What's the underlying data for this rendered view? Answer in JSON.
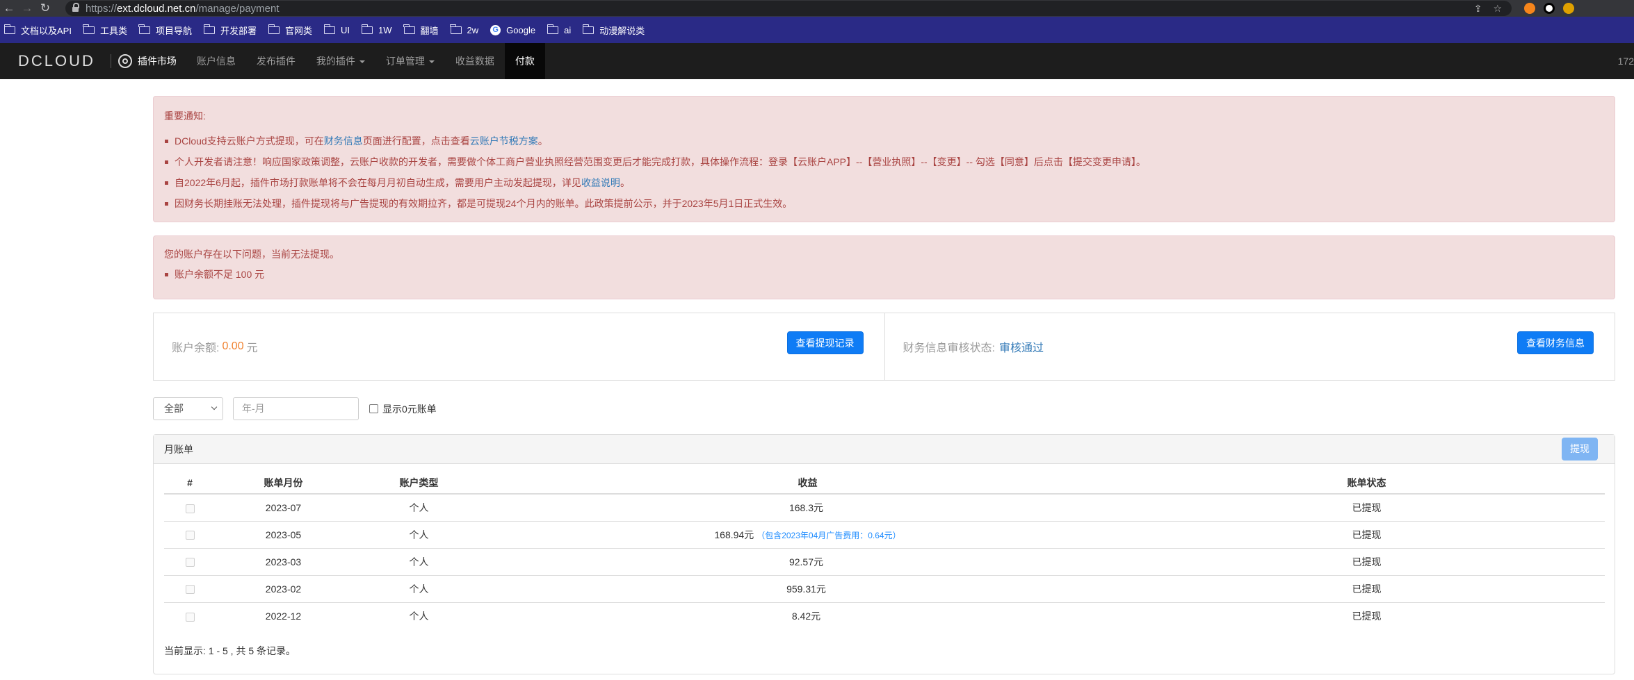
{
  "browser": {
    "url_scheme": "https://",
    "url_host": "ext.dcloud.net.cn",
    "url_path": "/manage/payment",
    "bookmarks": [
      "文档以及API",
      "工具类",
      "项目导航",
      "开发部署",
      "官网类",
      "UI",
      "1W",
      "翻墙",
      "2w",
      "Google",
      "ai",
      "动漫解说类"
    ]
  },
  "navbar": {
    "logo": "DCLOUD",
    "brand": "插件市场",
    "items": [
      "账户信息",
      "发布插件",
      "我的插件",
      "订单管理",
      "收益数据",
      "付款"
    ],
    "right_text": "172"
  },
  "notice": {
    "title": "重要通知:",
    "item1_pre": "DCloud支持云账户方式提现，可在",
    "item1_link1": "财务信息",
    "item1_mid": "页面进行配置，点击查看",
    "item1_link2": "云账户节税方案",
    "item1_end": "。",
    "item2": "个人开发者请注意！响应国家政策调整，云账户收款的开发者，需要做个体工商户营业执照经营范围变更后才能完成打款，具体操作流程：登录【云账户APP】--【营业执照】--【变更】-- 勾选【同意】后点击【提交变更申请】。",
    "item3_pre": "自2022年6月起，插件市场打款账单将不会在每月月初自动生成，需要用户主动发起提现，详见",
    "item3_link": "收益说明",
    "item3_end": "。",
    "item4": "因财务长期挂账无法处理，插件提现将与广告提现的有效期拉齐，都是可提现24个月内的账单。此政策提前公示，并于2023年5月1日正式生效。"
  },
  "issue": {
    "title": "您的账户存在以下问题，当前无法提现。",
    "item": "账户余额不足 100 元"
  },
  "balance": {
    "label": "账户余额:",
    "amount": "0.00",
    "unit": "元",
    "records_button": "查看提现记录",
    "review_label": "财务信息审核状态:",
    "review_status": "审核通过",
    "finance_button": "查看财务信息"
  },
  "filters": {
    "select_value": "全部",
    "month_placeholder": "年-月",
    "show_zero_label": "显示0元账单"
  },
  "bills": {
    "title": "月账单",
    "withdraw_button": "提现",
    "columns": [
      "#",
      "账单月份",
      "账户类型",
      "收益",
      "账单状态"
    ],
    "rows": [
      {
        "month": "2023-07",
        "type": "个人",
        "income": "168.3元",
        "note": "",
        "status": "已提现"
      },
      {
        "month": "2023-05",
        "type": "个人",
        "income": "168.94元",
        "note": "（包含2023年04月广告费用：0.64元）",
        "status": "已提现"
      },
      {
        "month": "2023-03",
        "type": "个人",
        "income": "92.57元",
        "note": "",
        "status": "已提现"
      },
      {
        "month": "2023-02",
        "type": "个人",
        "income": "959.31元",
        "note": "",
        "status": "已提现"
      },
      {
        "month": "2022-12",
        "type": "个人",
        "income": "8.42元",
        "note": "",
        "status": "已提现"
      }
    ],
    "footer": "当前显示: 1 - 5 , 共 5 条记录。"
  }
}
